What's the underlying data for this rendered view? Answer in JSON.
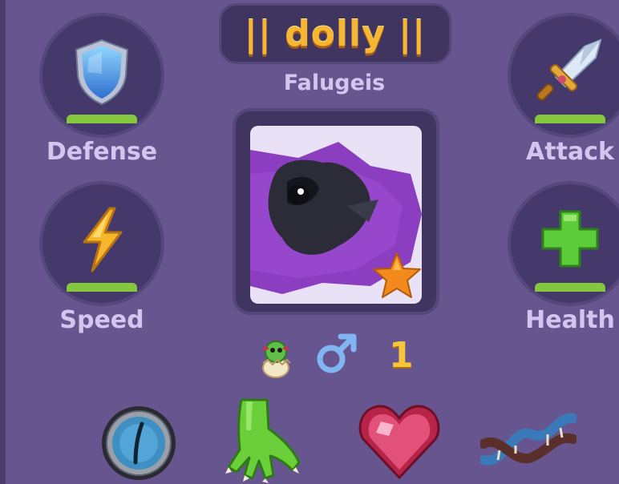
{
  "pet": {
    "name": "|| dolly ||",
    "species": "Falugeis",
    "level": "1",
    "gender_icon": "male-symbol-icon",
    "rarity_icon": "star-icon",
    "stage_icon": "hatchling-egg-icon"
  },
  "stats": {
    "defense": {
      "label": "Defense",
      "icon": "shield-icon",
      "fill": 1.0
    },
    "attack": {
      "label": "Attack",
      "icon": "sword-icon",
      "fill": 1.0
    },
    "speed": {
      "label": "Speed",
      "icon": "lightning-icon",
      "fill": 1.0
    },
    "health": {
      "label": "Health",
      "icon": "plus-icon",
      "fill": 1.0
    }
  },
  "traits": [
    {
      "icon": "eye-icon"
    },
    {
      "icon": "claw-foot-icon"
    },
    {
      "icon": "gem-heart-icon"
    },
    {
      "icon": "dna-icon"
    }
  ],
  "colors": {
    "panel": "#66558f",
    "name_gold": "#f5b733",
    "bar_green": "#84c63d",
    "label": "#d2c6ef"
  }
}
